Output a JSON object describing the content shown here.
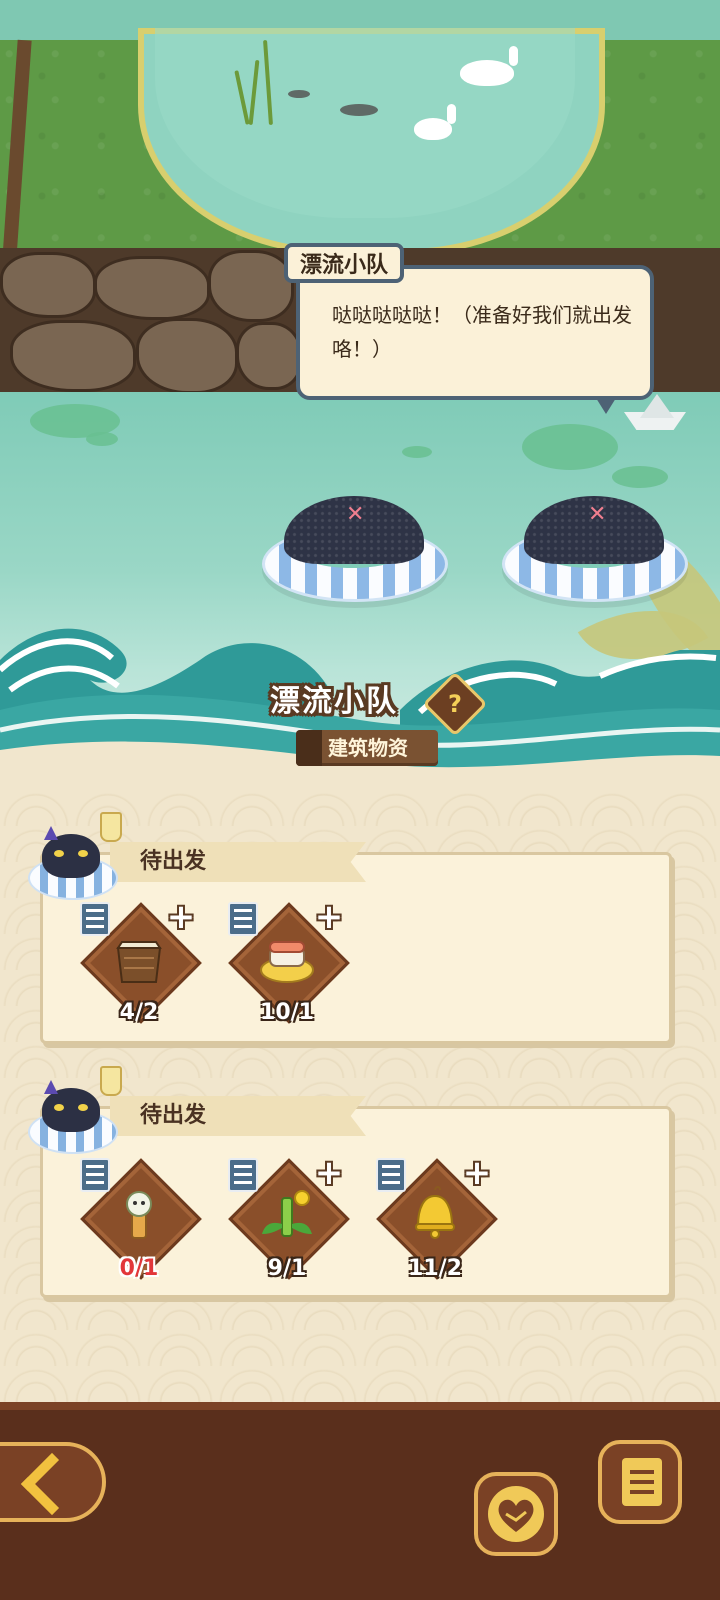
{
  "speech": {
    "speaker": "漂流小队",
    "text": "哒哒哒哒哒！（准备好我们就出发咯！）"
  },
  "team": {
    "title": "漂流小队",
    "help_icon": "question-icon",
    "materials_label": "建筑物资"
  },
  "groups": [
    {
      "status": "待出发",
      "items": [
        {
          "icon": "rice-sack-icon",
          "count": "4/2",
          "sufficient": true,
          "has_plus": true
        },
        {
          "icon": "sushi-plate-icon",
          "count": "10/1",
          "sufficient": true,
          "has_plus": true
        }
      ]
    },
    {
      "status": "待出发",
      "items": [
        {
          "icon": "cat-popsicle-icon",
          "count": "0/1",
          "sufficient": false,
          "has_plus": false
        },
        {
          "icon": "bamboo-flower-icon",
          "count": "9/1",
          "sufficient": true,
          "has_plus": true
        },
        {
          "icon": "golden-bell-icon",
          "count": "11/2",
          "sufficient": true,
          "has_plus": true
        }
      ]
    }
  ],
  "bottom": {
    "back_icon": "chevron-left-icon",
    "friends_icon": "handshake-heart-icon",
    "log_icon": "scroll-log-icon"
  },
  "colors": {
    "panel_bg": "#f1e6cd",
    "card_bg": "#fbf2da",
    "frame_brown": "#5a2f1c",
    "gold": "#e6b25a",
    "lack_red": "#e2373a"
  }
}
